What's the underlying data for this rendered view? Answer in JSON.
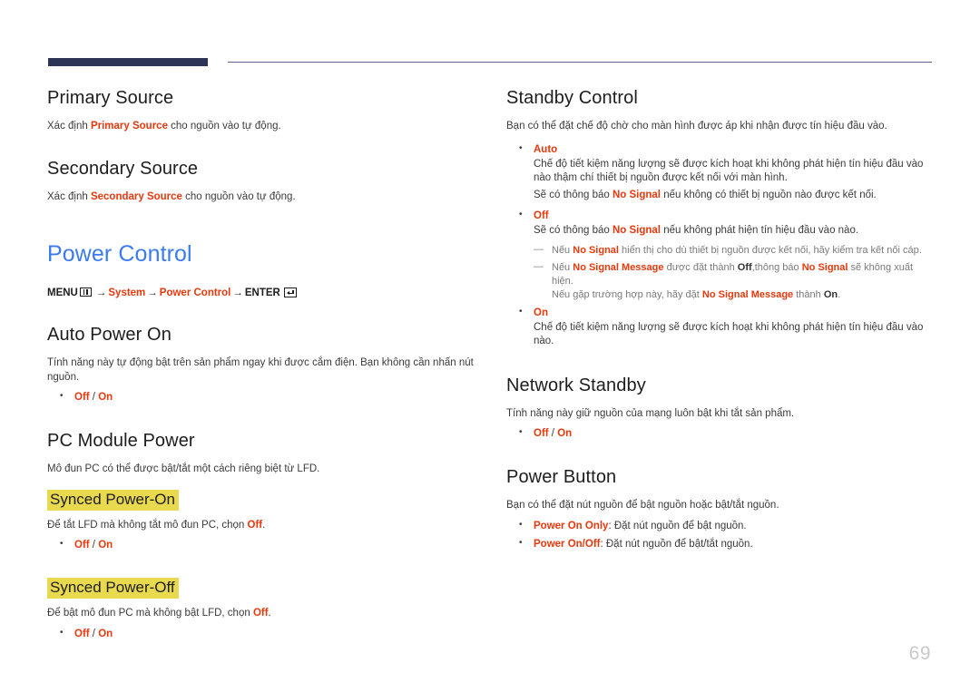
{
  "page": {
    "number": "69"
  },
  "left_column": {
    "primary_source": {
      "title": "Primary Source",
      "desc_pre": "Xác định ",
      "desc_term": "Primary Source",
      "desc_post": " cho nguồn vào tự động."
    },
    "secondary_source": {
      "title": "Secondary Source",
      "desc_pre": "Xác định ",
      "desc_term": "Secondary Source",
      "desc_post": " cho nguồn vào tự động."
    },
    "power_control": {
      "title": "Power Control",
      "menu_label": "MENU",
      "menu_icon": "menu-grid-icon",
      "arrow1": "→",
      "item_system": "System",
      "arrow2": "→",
      "item_power_control": "Power Control",
      "arrow3": "→",
      "enter_label": "ENTER",
      "enter_icon": "enter-key-icon"
    },
    "auto_power_on": {
      "title": "Auto Power On",
      "desc": "Tính năng này tự động bật trên sản phẩm ngay khi được cắm điện. Bạn không cần nhấn nút nguồn.",
      "options": {
        "off": "Off",
        "sep": " / ",
        "on": "On"
      }
    },
    "pc_module_power": {
      "title": "PC Module Power",
      "desc": "Mô đun PC có thể được bật/tắt một cách riêng biệt từ LFD.",
      "synced_power_on": {
        "title": "Synced Power-On",
        "desc_pre": "Để tắt LFD mà không tắt mô đun PC, chọn ",
        "desc_term": "Off",
        "desc_post": ".",
        "options": {
          "off": "Off",
          "sep": " / ",
          "on": "On"
        }
      },
      "synced_power_off": {
        "title": "Synced Power-Off",
        "desc_pre": "Để bật mô đun PC mà không bật LFD, chọn ",
        "desc_term": "Off",
        "desc_post": ".",
        "options": {
          "off": "Off",
          "sep": " / ",
          "on": "On"
        }
      }
    }
  },
  "right_column": {
    "standby_control": {
      "title": "Standby Control",
      "desc": "Bạn có thể đặt chế độ chờ cho màn hình được áp khi nhận được tín hiệu đầu vào.",
      "option_auto": {
        "label": "Auto",
        "line1": "Chế độ tiết kiệm năng lượng sẽ được kích hoạt khi không phát hiện tín hiệu đầu vào nào thậm chí thiết bị nguồn được kết nối với màn hình.",
        "line2_pre": "Sẽ có thông báo ",
        "line2_term": "No Signal",
        "line2_post": " nếu không có thiết bị nguồn nào được kết nối."
      },
      "option_off": {
        "label": "Off",
        "line1_pre": "Sẽ có thông báo ",
        "line1_term": "No Signal",
        "line1_post": " nếu không phát hiện tín hiệu đầu vào nào.",
        "note1_pre": "Nếu ",
        "note1_term": "No Signal",
        "note1_post": " hiển thị cho dù thiết bị nguồn được kết nối, hãy kiểm tra kết nối cáp.",
        "note2_pre": "Nếu ",
        "note2_term1": "No Signal Message",
        "note2_mid1": " được đặt thành ",
        "note2_term2": "Off",
        "note2_mid2": ",thông báo ",
        "note2_term3": "No Signal",
        "note2_post": " sẽ không xuất hiện.",
        "note2_cont_pre": "Nếu gặp trường hợp này, hãy đặt ",
        "note2_cont_term1": "No Signal Message",
        "note2_cont_mid": " thành ",
        "note2_cont_term2": "On",
        "note2_cont_post": "."
      },
      "option_on": {
        "label": "On",
        "line1": "Chế độ tiết kiệm năng lượng sẽ được kích hoạt khi không phát hiện tín hiệu đầu vào nào."
      }
    },
    "network_standby": {
      "title": "Network Standby",
      "desc": "Tính năng này giữ nguồn của mạng luôn bật khi tắt sản phẩm.",
      "options": {
        "off": "Off",
        "sep": " / ",
        "on": "On"
      }
    },
    "power_button": {
      "title": "Power Button",
      "desc": "Bạn có thể đặt nút nguồn để bật nguồn hoặc bật/tắt nguồn.",
      "option1_term": "Power On Only",
      "option1_text": ": Đặt nút nguồn để bật nguồn.",
      "option2_term": "Power On/Off",
      "option2_text": ": Đặt nút nguồn để bật/tắt nguồn."
    }
  },
  "colors": {
    "accent_blue": "#3a7bf0",
    "accent_red": "#e8380d",
    "highlight_yellow": "#e8d94e",
    "header_bar": "#2d3455",
    "page_number_gray": "#c9c9c9"
  }
}
